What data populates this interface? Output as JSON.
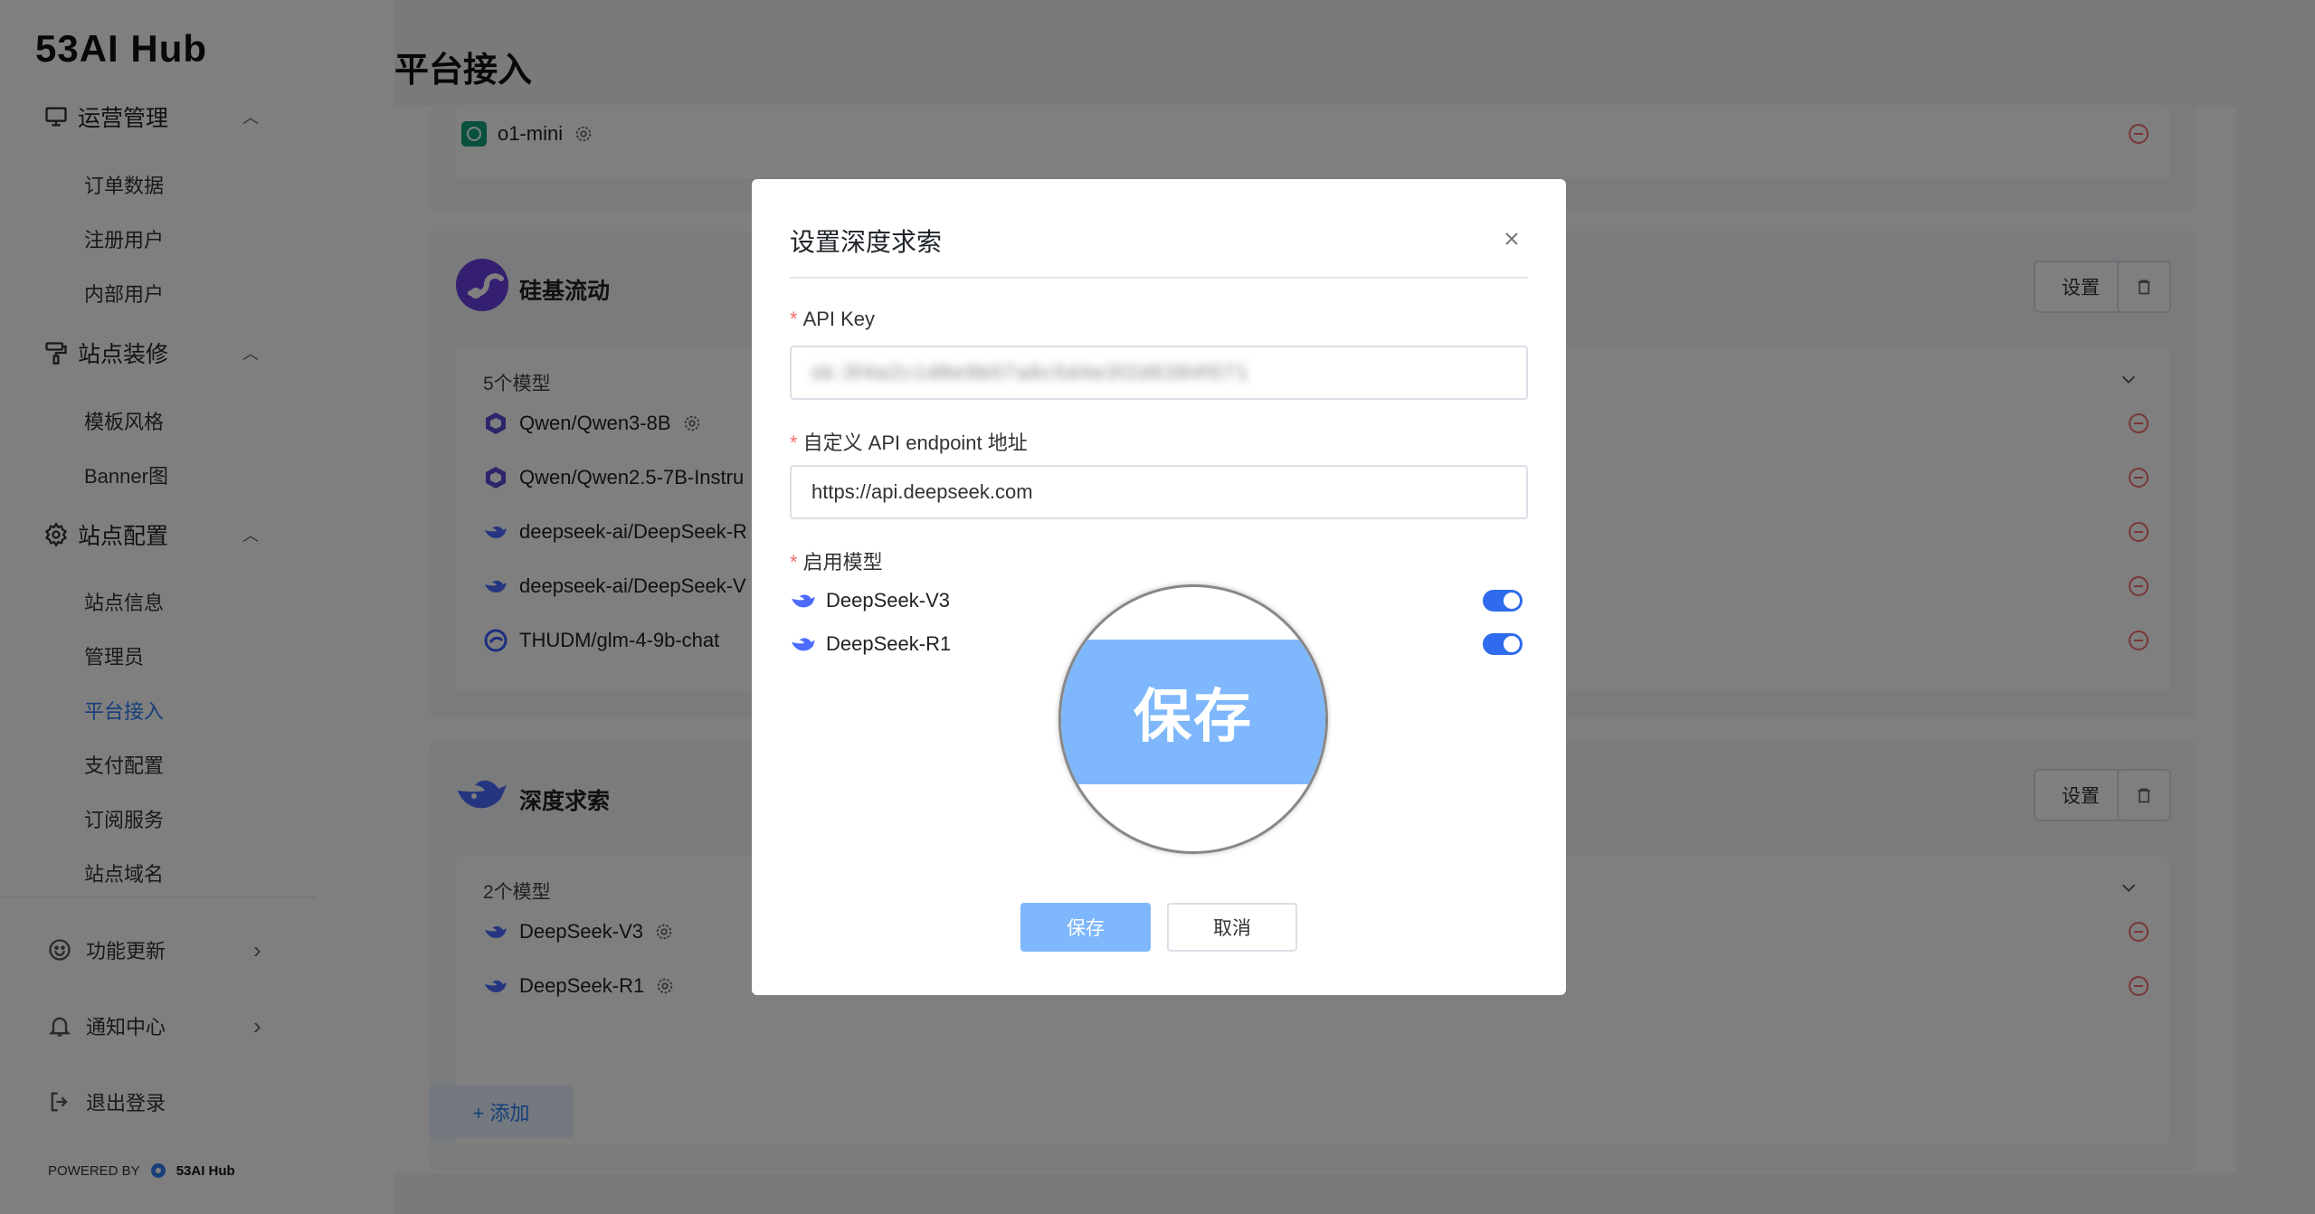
{
  "sidebar": {
    "brand": "53AI Hub",
    "groups": [
      {
        "label": "运营管理",
        "icon": "monitor-icon",
        "items": [
          "订单数据",
          "注册用户",
          "内部用户"
        ]
      },
      {
        "label": "站点装修",
        "icon": "paint-roller-icon",
        "items": [
          "模板风格",
          "Banner图"
        ]
      },
      {
        "label": "站点配置",
        "icon": "gear-icon",
        "items": [
          "站点信息",
          "管理员",
          "平台接入",
          "支付配置",
          "订阅服务",
          "站点域名"
        ]
      }
    ],
    "active_item": "平台接入",
    "bottom": [
      {
        "label": "功能更新",
        "icon": "update-icon"
      },
      {
        "label": "通知中心",
        "icon": "bell-icon"
      },
      {
        "label": "退出登录",
        "icon": "logout-icon"
      }
    ],
    "powered_by": "POWERED BY",
    "powered_logo": "53AI Hub"
  },
  "main": {
    "title": "平台接入",
    "cards": [
      {
        "name": "",
        "models": [
          {
            "name": "o1-mini"
          }
        ]
      },
      {
        "name": "硅基流动",
        "settings_label": "设置",
        "model_count": "5个模型",
        "models": [
          {
            "name": "Qwen/Qwen3-8B"
          },
          {
            "name": "Qwen/Qwen2.5-7B-Instru"
          },
          {
            "name": "deepseek-ai/DeepSeek-R"
          },
          {
            "name": "deepseek-ai/DeepSeek-V"
          },
          {
            "name": "THUDM/glm-4-9b-chat"
          }
        ]
      },
      {
        "name": "深度求索",
        "settings_label": "设置",
        "model_count": "2个模型",
        "models": [
          {
            "name": "DeepSeek-V3"
          },
          {
            "name": "DeepSeek-R1"
          }
        ]
      }
    ],
    "add_label": "+ 添加"
  },
  "modal": {
    "title": "设置深度求索",
    "api_key_label": "API Key",
    "api_key_value": "sk-3f4a2c1d8e9b07a6c5d4e3f2d6384f071",
    "endpoint_label": "自定义 API endpoint 地址",
    "endpoint_value": "https://api.deepseek.com",
    "models_label": "启用模型",
    "models": [
      {
        "name": "DeepSeek-V3",
        "enabled": true
      },
      {
        "name": "DeepSeek-R1",
        "enabled": true
      }
    ],
    "save_label": "保存",
    "cancel_label": "取消"
  },
  "magnifier": {
    "text": "保存"
  },
  "colors": {
    "accent": "#2f7ef5",
    "toggle_on": "#2f6bec",
    "save_button": "#7eb7fb",
    "danger": "#f56c6c",
    "overlay": "rgba(0,0,0,0.5)"
  }
}
